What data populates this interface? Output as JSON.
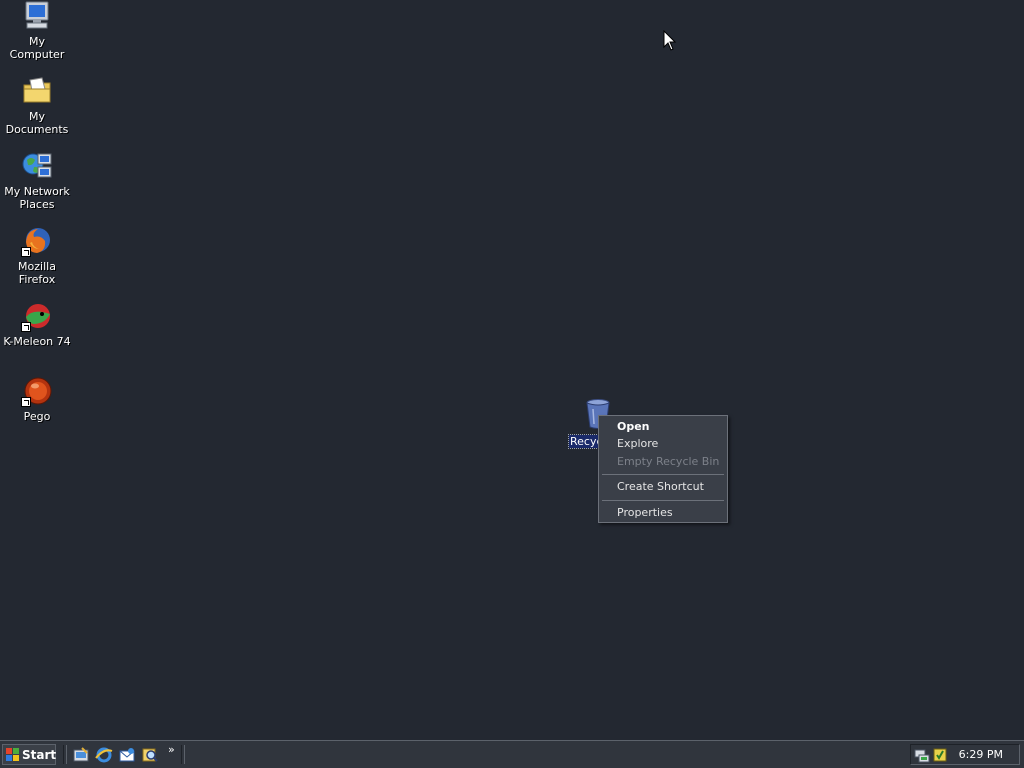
{
  "desktop": {
    "icons": [
      {
        "label_line1": "My Computer",
        "label_line2": ""
      },
      {
        "label_line1": "My Documents",
        "label_line2": ""
      },
      {
        "label_line1": "My Network",
        "label_line2": "Places"
      },
      {
        "label_line1": "Mozilla Firefox",
        "label_line2": ""
      },
      {
        "label_line1": "K-Meleon 74",
        "label_line2": ""
      },
      {
        "label_line1": "Pego",
        "label_line2": ""
      }
    ],
    "recycle_bin_label": "Recyc"
  },
  "context_menu": {
    "items": [
      {
        "label": "Open"
      },
      {
        "label": "Explore"
      },
      {
        "label": "Empty Recycle Bin"
      },
      {
        "label": "Create Shortcut"
      },
      {
        "label": "Properties"
      }
    ]
  },
  "taskbar": {
    "start_label": "Start",
    "overflow_label": "»",
    "clock": "6:29 PM"
  },
  "colors": {
    "desktop_bg": "#232831",
    "taskbar_bg": "#30353d",
    "menu_bg": "#3a3f48",
    "selection": "#1a2a6a"
  }
}
